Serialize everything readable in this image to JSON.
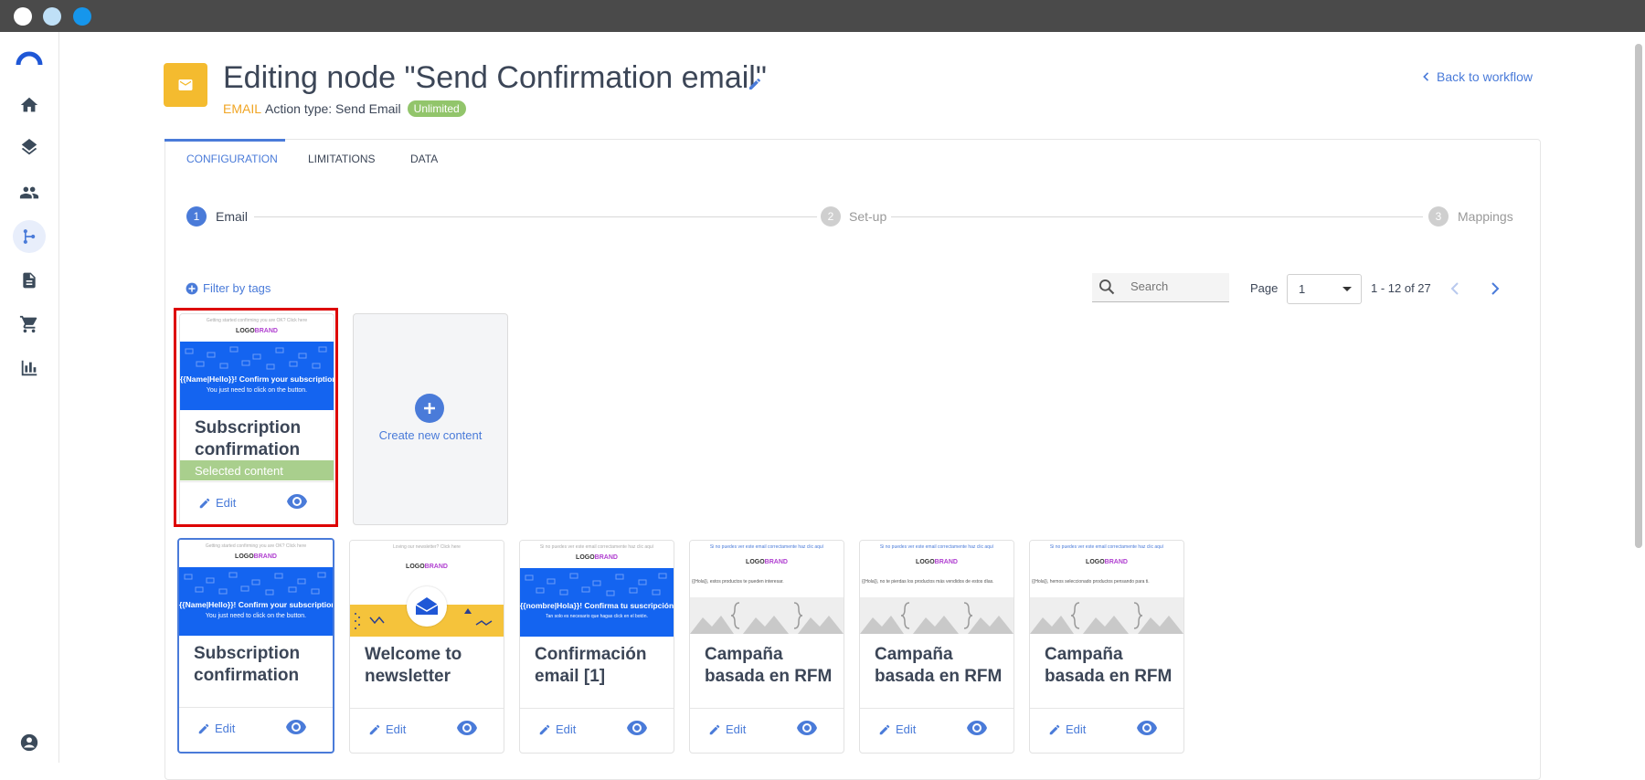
{
  "window": {
    "dots": [
      "#ffffff",
      "#bfe0f7",
      "#1696ec"
    ]
  },
  "sidebar": {
    "items": [
      {
        "name": "brand-logo-icon"
      },
      {
        "name": "home-icon"
      },
      {
        "name": "layers-icon"
      },
      {
        "name": "people-icon"
      },
      {
        "name": "workflow-icon",
        "active": true
      },
      {
        "name": "document-icon"
      },
      {
        "name": "cart-icon"
      },
      {
        "name": "bar-chart-icon"
      },
      {
        "name": "account-icon"
      }
    ]
  },
  "header": {
    "title": "Editing node \"Send Confirmation email\"",
    "email_tag": "EMAIL",
    "action_type": "Action type: Send Email",
    "badge": "Unlimited",
    "back_label": "Back to workflow"
  },
  "tabs": [
    {
      "label": "CONFIGURATION",
      "active": true
    },
    {
      "label": "LIMITATIONS"
    },
    {
      "label": "DATA"
    }
  ],
  "steps": [
    {
      "num": "1",
      "label": "Email",
      "active": true
    },
    {
      "num": "2",
      "label": "Set-up"
    },
    {
      "num": "3",
      "label": "Mappings"
    }
  ],
  "toolbar": {
    "filter_label": "Filter by tags",
    "search_placeholder": "Search",
    "page_label": "Page",
    "page_value": "1",
    "range": "1 - 12 of 27"
  },
  "selected_card": {
    "title": "Subscription confirmation",
    "status": "Selected content",
    "edit_label": "Edit",
    "thumb": {
      "small": "Getting started confirming you are OK? Click here",
      "logo_a": "LOGO",
      "logo_b": "BRAND",
      "headline": "{{Name|Hello}}! Confirm your subscription",
      "sub": "You just need to click on the button."
    }
  },
  "create_card": {
    "label": "Create new content"
  },
  "cards": [
    {
      "title": "Subscription confirmation",
      "edit_label": "Edit",
      "thumb": {
        "small": "Getting started confirming you are OK? Click here",
        "logo_a": "LOGO",
        "logo_b": "BRAND",
        "headline": "{{Name|Hello}}! Confirm your subscription",
        "sub": "You just need to click on the button."
      }
    },
    {
      "title": "Welcome to newsletter",
      "edit_label": "Edit",
      "thumb": {
        "small": "Loving our newsletter? Click here",
        "logo_a": "LOGO",
        "logo_b": "BRAND"
      }
    },
    {
      "title": "Confirmación email [1]",
      "edit_label": "Edit",
      "thumb": {
        "small": "Si no puedes ver este email correctamente haz clic aquí",
        "logo_a": "LOGO",
        "logo_b": "BRAND",
        "headline": "{{nombre|Hola}}! Confirma tu suscripción",
        "sub": "Tan solo es necesario que hagas click en el botón."
      }
    },
    {
      "title": "Campaña basada en RFM",
      "edit_label": "Edit",
      "thumb": {
        "small": "Si no puedes ver este email correctamente haz clic aquí",
        "logo_a": "LOGO",
        "logo_b": "BRAND",
        "body": "{{Hola}}, estos productos te pueden interesar."
      }
    },
    {
      "title": "Campaña basada en RFM",
      "edit_label": "Edit",
      "thumb": {
        "small": "Si no puedes ver este email correctamente haz clic aquí",
        "logo_a": "LOGO",
        "logo_b": "BRAND",
        "body": "{{Hola}}, no te pierdas los productos más vendidos de estos días."
      }
    },
    {
      "title": "Campaña basada en RFM",
      "edit_label": "Edit",
      "thumb": {
        "small": "Si no puedes ver este email correctamente haz clic aquí",
        "logo_a": "LOGO",
        "logo_b": "BRAND",
        "body": "{{Hola}}, hemos seleccionado productos pensando para ti."
      }
    }
  ]
}
